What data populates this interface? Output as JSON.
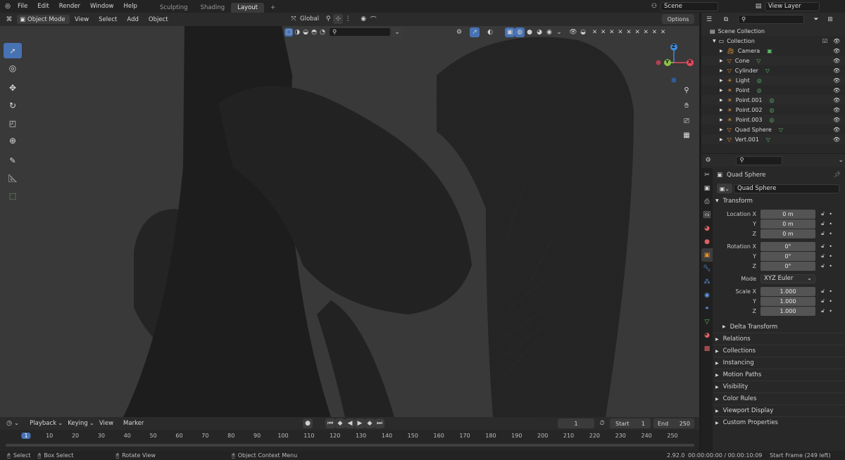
{
  "topbar": {
    "menus": [
      "File",
      "Edit",
      "Render",
      "Window",
      "Help"
    ],
    "workspaces": [
      "Sculpting",
      "Shading",
      "Layout"
    ],
    "active_workspace": "Layout",
    "add_tab": "+",
    "scene": "Scene",
    "view_layer": "View Layer"
  },
  "viewport_header": {
    "mode": "Object Mode",
    "menus": [
      "View",
      "Select",
      "Add",
      "Object"
    ],
    "transform_orientation": "Global",
    "options": "Options"
  },
  "gizmo": {
    "x": "X",
    "y": "Y",
    "z": "Z"
  },
  "outliner": {
    "root": "Scene Collection",
    "collection": "Collection",
    "items": [
      {
        "name": "Camera",
        "type": "camera"
      },
      {
        "name": "Cone",
        "type": "mesh"
      },
      {
        "name": "Cylinder",
        "type": "mesh"
      },
      {
        "name": "Light",
        "type": "light"
      },
      {
        "name": "Point",
        "type": "light"
      },
      {
        "name": "Point.001",
        "type": "light"
      },
      {
        "name": "Point.002",
        "type": "light"
      },
      {
        "name": "Point.003",
        "type": "light"
      },
      {
        "name": "Quad Sphere",
        "type": "mesh"
      },
      {
        "name": "Vert.001",
        "type": "mesh"
      }
    ]
  },
  "properties": {
    "object_name_header": "Quad Sphere",
    "object_name_field": "Quad Sphere",
    "transform_title": "Transform",
    "location": {
      "label": "Location X",
      "x": "0 m",
      "y": "0 m",
      "z": "0 m"
    },
    "rotation": {
      "label": "Rotation X",
      "x": "0°",
      "y": "0°",
      "z": "0°"
    },
    "mode_label": "Mode",
    "mode_value": "XYZ Euler",
    "scale": {
      "label": "Scale X",
      "x": "1.000",
      "y": "1.000",
      "z": "1.000"
    },
    "axis_y": "Y",
    "axis_z": "Z",
    "delta_transform": "Delta Transform",
    "panels": [
      "Relations",
      "Collections",
      "Instancing",
      "Motion Paths",
      "Visibility",
      "Color Rules",
      "Viewport Display",
      "Custom Properties"
    ]
  },
  "timeline": {
    "menus": [
      "Playback",
      "Keying",
      "View",
      "Marker"
    ],
    "current_frame": "1",
    "start_label": "Start",
    "start": "1",
    "end_label": "End",
    "end": "250",
    "ticks": [
      "1",
      "10",
      "20",
      "30",
      "40",
      "50",
      "60",
      "70",
      "80",
      "90",
      "100",
      "110",
      "120",
      "130",
      "140",
      "150",
      "160",
      "170",
      "180",
      "190",
      "200",
      "210",
      "220",
      "230",
      "240",
      "250"
    ]
  },
  "statusbar": {
    "select": "Select",
    "box_select": "Box Select",
    "rotate_view": "Rotate View",
    "context_menu": "Object Context Menu",
    "version": "2.92.0",
    "time": "00:00:00:00 / 00:00:10:09",
    "start_frame": "Start Frame (249 left)"
  },
  "colors": {
    "accent": "#4772b3",
    "x_axis": "#e84a5f",
    "y_axis": "#8bc34a",
    "z_axis": "#3d8bd9",
    "mesh_green": "#5bbf6a",
    "object_orange": "#e0902c"
  }
}
